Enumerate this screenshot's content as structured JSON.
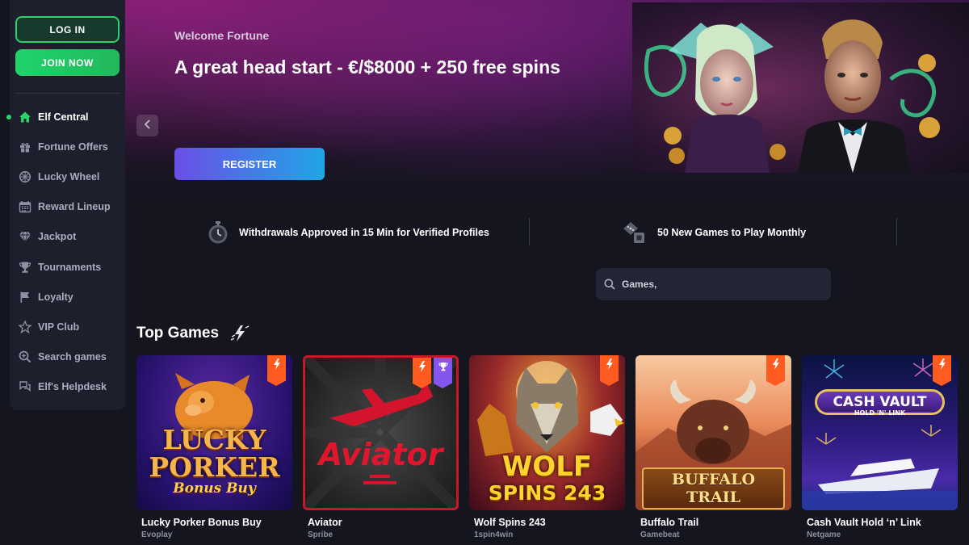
{
  "sidebar": {
    "login_label": "LOG IN",
    "join_label": "JOIN NOW",
    "items": [
      {
        "label": "Elf Central",
        "icon": "home-icon",
        "active": true
      },
      {
        "label": "Fortune Offers",
        "icon": "gift-icon"
      },
      {
        "label": "Lucky Wheel",
        "icon": "wheel-icon"
      },
      {
        "label": "Reward Lineup",
        "icon": "calendar-icon"
      },
      {
        "label": "Jackpot",
        "icon": "diamond-icon"
      },
      {
        "label": "Tournaments",
        "icon": "trophy-icon"
      },
      {
        "label": "Loyalty",
        "icon": "flag-icon"
      },
      {
        "label": "VIP Club",
        "icon": "star-icon"
      },
      {
        "label": "Search games",
        "icon": "search-icon"
      },
      {
        "label": "Elf's Helpdesk",
        "icon": "chat-icon"
      }
    ]
  },
  "hero": {
    "welcome": "Welcome Fortune",
    "title": "A great head start - €/$8000 + 250 free spins",
    "register_label": "REGISTER"
  },
  "features": [
    {
      "text": "Withdrawals Approved in 15 Min for Verified Profiles",
      "icon": "stopwatch-icon"
    },
    {
      "text": "50 New Games to Play Monthly",
      "icon": "dice-icon"
    }
  ],
  "search": {
    "placeholder": "Games,"
  },
  "top_games": {
    "title": "Top Games",
    "games": [
      {
        "name": "Lucky Porker Bonus Buy",
        "provider": "Evoplay",
        "art": "LUCKY PORKER",
        "art_sub": "Bonus Buy"
      },
      {
        "name": "Aviator",
        "provider": "Spribe",
        "art": "Aviator"
      },
      {
        "name": "Wolf Spins 243",
        "provider": "1spin4win",
        "art": "WOLF",
        "art_sub": "SPINS 243"
      },
      {
        "name": "Buffalo Trail",
        "provider": "Gamebeat",
        "art": "BUFFALO TRAIL"
      },
      {
        "name": "Cash Vault Hold ‘n’ Link",
        "provider": "Netgame",
        "art": "CASH VAULT",
        "art_sub": "HOLD 'N' LINK"
      }
    ]
  },
  "colors": {
    "accent_green": "#2cd36a",
    "hot_badge": "#ff5a1f",
    "cup_badge": "#8456ee"
  }
}
